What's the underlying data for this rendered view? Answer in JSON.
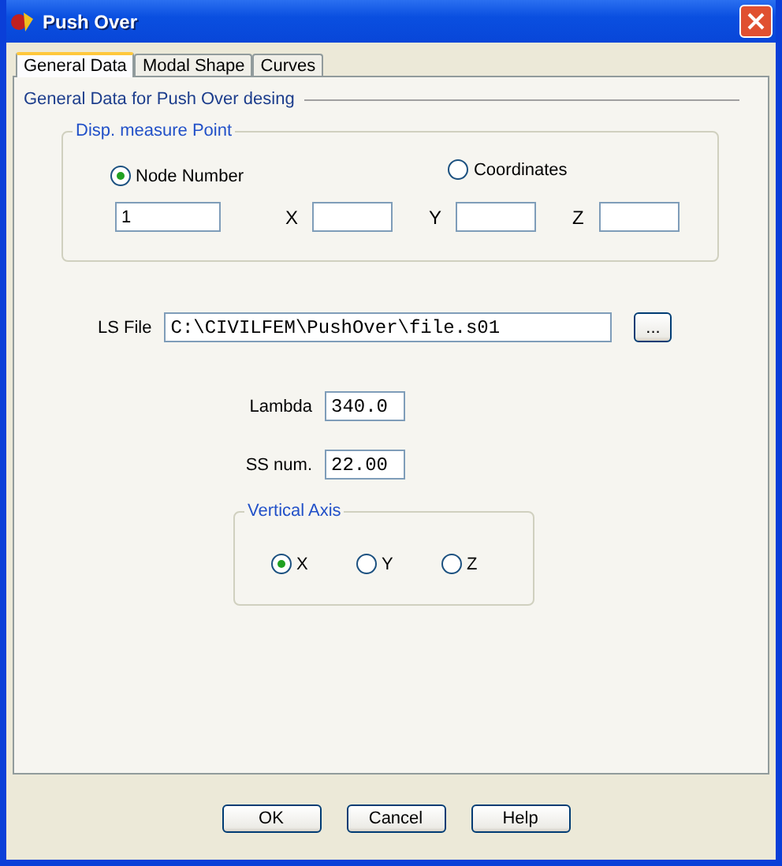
{
  "window": {
    "title": "Push Over"
  },
  "tabs": [
    {
      "label": "General Data",
      "selected": true
    },
    {
      "label": "Modal Shape",
      "selected": false
    },
    {
      "label": "Curves",
      "selected": false
    }
  ],
  "section_title": "General Data for Push Over desing",
  "disp_point": {
    "title": "Disp. measure Point",
    "options": [
      {
        "label": "Node Number",
        "selected": true
      },
      {
        "label": "Coordinates",
        "selected": false
      }
    ],
    "node_value": "1",
    "coordinates": [
      {
        "label": "X"
      },
      {
        "label": "Y"
      },
      {
        "label": "Z"
      }
    ]
  },
  "ls_file": {
    "label": "LS File",
    "value": "C:\\CIVILFEM\\PushOver\\file.s01",
    "browse": "..."
  },
  "fields": [
    {
      "label": "Lambda",
      "value": "340.0"
    },
    {
      "label": "SS num.",
      "value": "22.00"
    }
  ],
  "vertical_axis": {
    "title": "Vertical Axis",
    "options": [
      {
        "label": "X",
        "selected": true
      },
      {
        "label": "Y",
        "selected": false
      },
      {
        "label": "Z",
        "selected": false
      }
    ]
  },
  "buttons": [
    "OK",
    "Cancel",
    "Help"
  ]
}
